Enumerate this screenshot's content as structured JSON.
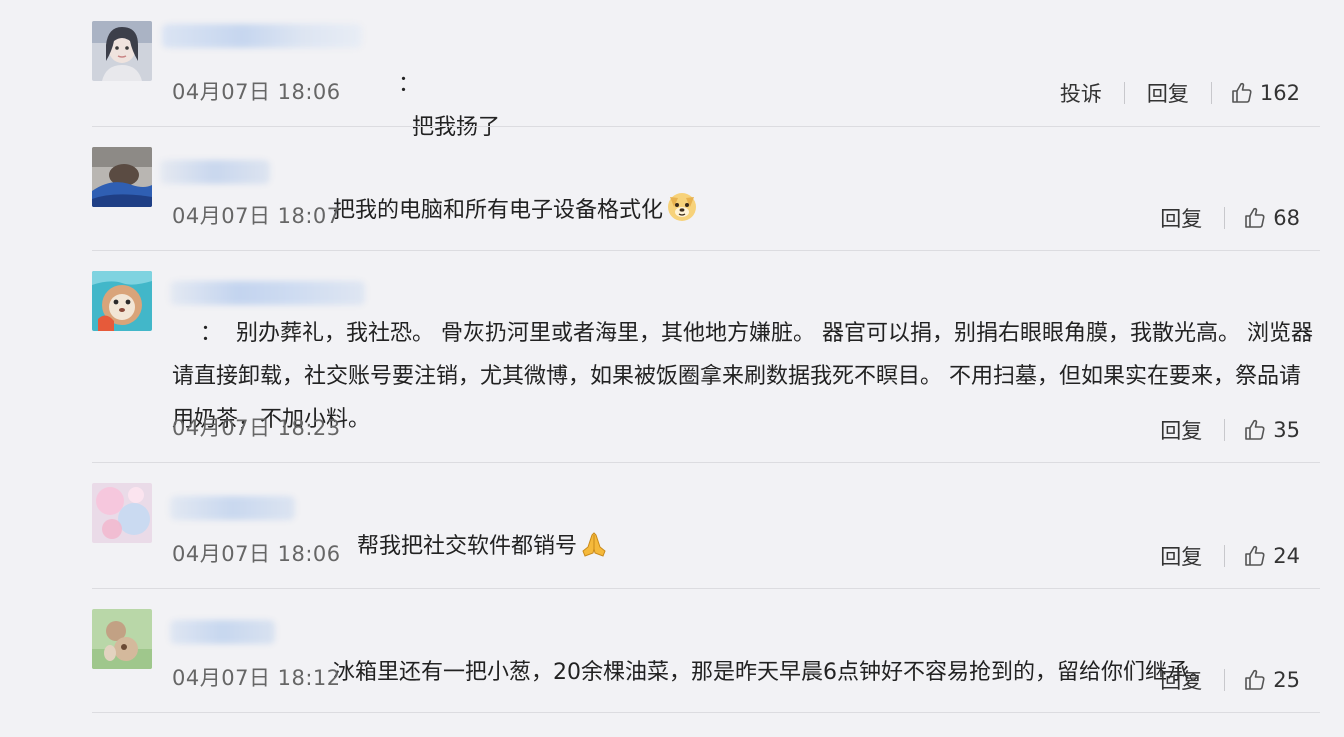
{
  "comments": [
    {
      "text": "把我扬了",
      "colon": "：",
      "time": "04月07日 18:06",
      "report": "投诉",
      "reply": "回复",
      "likes": "162"
    },
    {
      "text": "把我的电脑和所有电子设备格式化",
      "time": "04月07日 18:07",
      "reply": "回复",
      "likes": "68",
      "emoji": "dog-face-icon"
    },
    {
      "text": "别办葬礼，我社恐。 骨灰扔河里或者海里，其他地方嫌脏。 器官可以捐，别捐右眼眼角膜，我散光高。 浏览器请直接卸载，社交账号要注销，尤其微博，如果被饭圈拿来刷数据我死不瞑目。 不用扫墓，但如果实在要来，祭品请用奶茶，不加小料。",
      "colon": "：",
      "time": "04月07日 18:23",
      "reply": "回复",
      "likes": "35"
    },
    {
      "text": "帮我把社交软件都销号",
      "time": "04月07日 18:06",
      "reply": "回复",
      "likes": "24",
      "emoji": "folded-hands-icon"
    },
    {
      "text": "冰箱里还有一把小葱，20余棵油菜，那是昨天早晨6点钟好不容易抢到的，留给你们继承。",
      "time": "04月07日 18:12",
      "reply": "回复",
      "likes": "25"
    }
  ]
}
